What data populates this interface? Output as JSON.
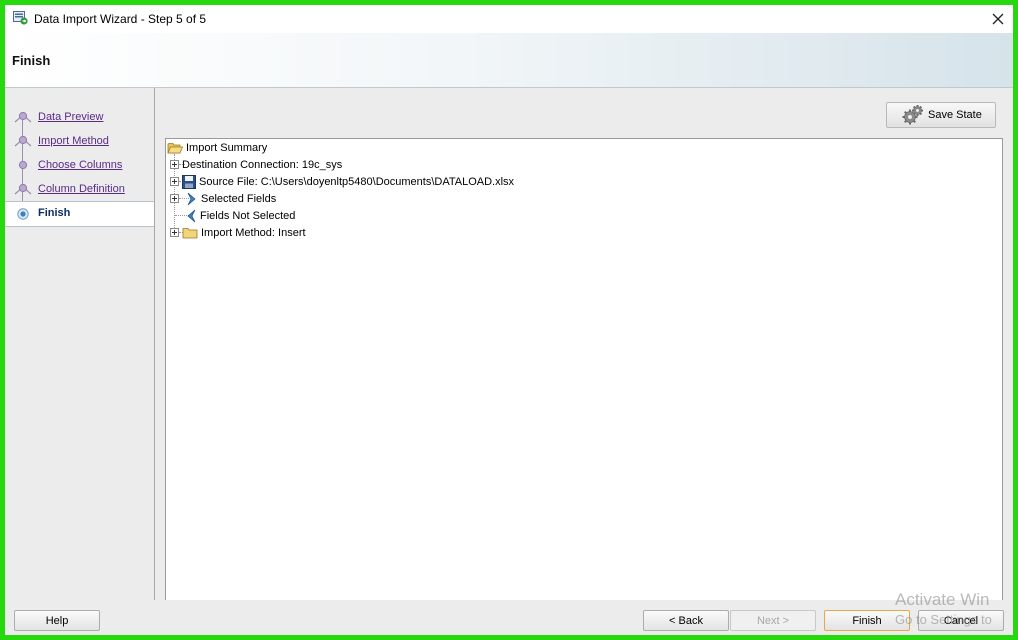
{
  "window": {
    "title": "Data Import Wizard - Step 5 of 5"
  },
  "header": {
    "title": "Finish"
  },
  "steps": [
    {
      "label": "Data Preview",
      "state": "visited"
    },
    {
      "label": "Import Method",
      "state": "visited"
    },
    {
      "label": "Choose Columns",
      "state": "visited"
    },
    {
      "label": "Column Definition",
      "state": "visited"
    },
    {
      "label": "Finish",
      "state": "active"
    }
  ],
  "toolbar": {
    "save_state_label": "Save State"
  },
  "summary_tree": {
    "root": "Import Summary",
    "items": [
      {
        "label": "Destination Connection: 19c_sys",
        "icon": "none",
        "expandable": true
      },
      {
        "label": "Source File: C:\\Users\\doyenltp5480\\Documents\\DATALOAD.xlsx",
        "icon": "disk-icon",
        "expandable": true
      },
      {
        "label": "Selected Fields",
        "icon": "chevron-right-icon",
        "expandable": true
      },
      {
        "label": "Fields Not Selected",
        "icon": "chevron-left-icon",
        "expandable": false
      },
      {
        "label": "Import Method: Insert",
        "icon": "folder-icon",
        "expandable": true
      }
    ]
  },
  "footer": {
    "help_label": "Help",
    "back_label": "< Back",
    "next_label": "Next >",
    "finish_label": "Finish",
    "cancel_label": "Cancel"
  },
  "watermark": {
    "line1": "Activate Win",
    "line2": "Go to Settings to"
  },
  "colors": {
    "frame": "#27d80f",
    "link": "#5a2a86",
    "active_step": "#0b2c6a",
    "default_button_border": "#e5a84b"
  }
}
